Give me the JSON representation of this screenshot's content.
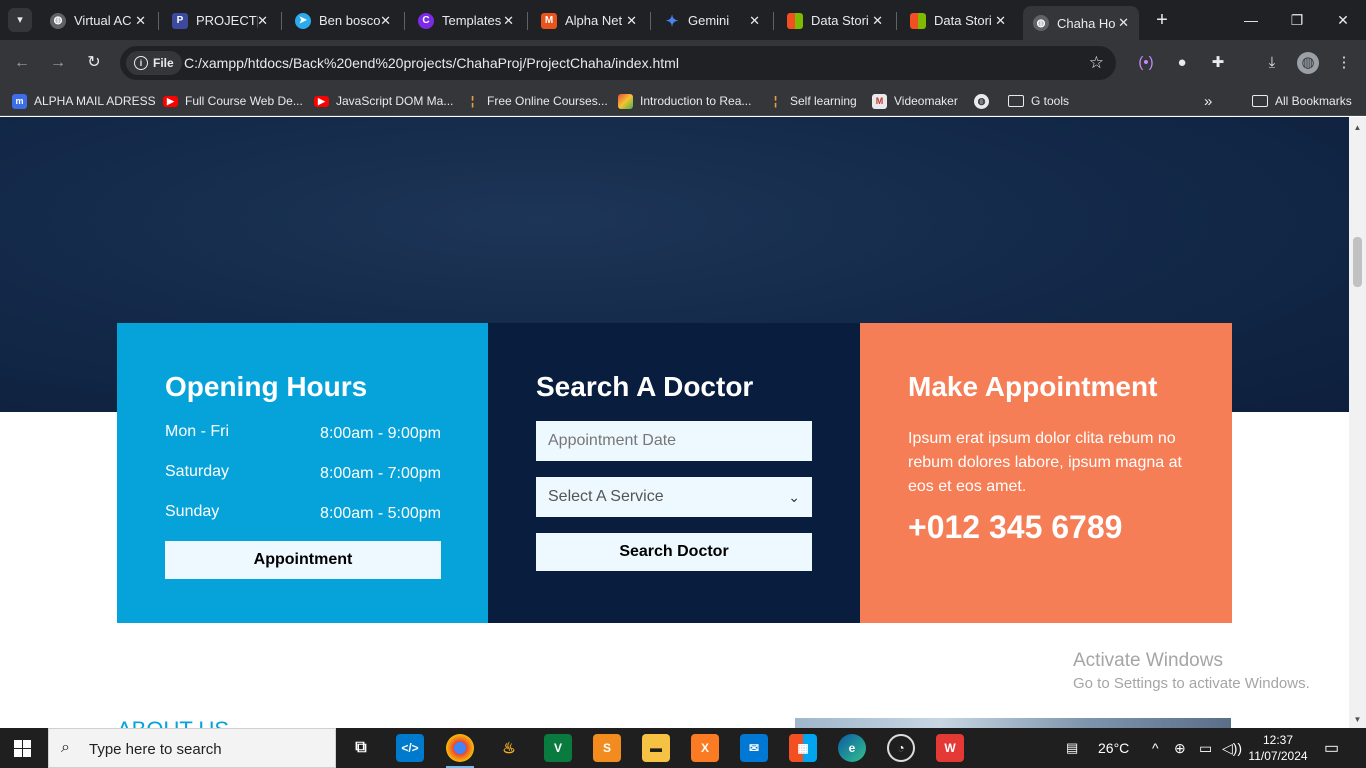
{
  "browser": {
    "tabs": [
      {
        "label": "Virtual AC",
        "icon": "globe-icon",
        "color": "#5f6368"
      },
      {
        "label": "PROJECT|",
        "icon": "project-icon",
        "color": "#3c4a9e"
      },
      {
        "label": "Ben bosco",
        "icon": "telegram-icon",
        "color": "#2aabee"
      },
      {
        "label": "Templates",
        "icon": "canva-icon",
        "color": "#7d2ae8"
      },
      {
        "label": "Alpha Net",
        "icon": "m-icon",
        "color": "#e8541d"
      },
      {
        "label": "Gemini",
        "icon": "gemini-icon",
        "color": "#4b82f1"
      },
      {
        "label": "Data Stori",
        "icon": "windows-icon",
        "color": "#f25022"
      },
      {
        "label": "Data Stori",
        "icon": "windows-icon",
        "color": "#f25022"
      },
      {
        "label": "Chaha Ho",
        "icon": "globe-icon",
        "color": "#5f6368"
      }
    ],
    "url_chip": "File",
    "url": "C:/xampp/htdocs/Back%20end%20projects/ChahaProj/ProjectChaha/index.html",
    "bookmarks": [
      {
        "label": "ALPHA MAIL ADRESS",
        "icon": "m-icon",
        "color": "#3c6ee8"
      },
      {
        "label": "Full Course Web De...",
        "icon": "youtube-icon",
        "color": "#ff0000"
      },
      {
        "label": "JavaScript DOM Ma...",
        "icon": "youtube-icon",
        "color": "#ff0000"
      },
      {
        "label": "Free Online Courses...",
        "icon": "chart-icon",
        "color": "#e8a33c"
      },
      {
        "label": "Introduction to Rea...",
        "icon": "coursera-icon",
        "color": "#e84c3c"
      },
      {
        "label": "Self learning",
        "icon": "chart-icon",
        "color": "#e8a33c"
      },
      {
        "label": "Videomaker",
        "icon": "video-icon",
        "color": "#e8eaed"
      },
      {
        "label": "G tools",
        "icon": "folder-icon",
        "color": "#e8eaed"
      }
    ],
    "all_bookmarks": "All Bookmarks"
  },
  "page": {
    "opening_hours": {
      "title": "Opening Hours",
      "rows": [
        {
          "day": "Mon - Fri",
          "time": "8:00am - 9:00pm"
        },
        {
          "day": "Saturday",
          "time": "8:00am - 7:00pm"
        },
        {
          "day": "Sunday",
          "time": "8:00am - 5:00pm"
        }
      ],
      "button": "Appointment"
    },
    "search_doctor": {
      "title": "Search A Doctor",
      "date_placeholder": "Appointment Date",
      "service_selected": "Select A Service",
      "button": "Search Doctor"
    },
    "make_appointment": {
      "title": "Make Appointment",
      "text": "Ipsum erat ipsum dolor clita rebum no rebum dolores labore, ipsum magna at eos et eos amet.",
      "phone": "+012 345 6789"
    },
    "about_heading": "ABOUT US",
    "colors": {
      "blue": "#06a3da",
      "navy": "#091e3e",
      "orange": "#f57e57"
    }
  },
  "windows": {
    "activate_title": "Activate Windows",
    "activate_sub": "Go to Settings to activate Windows.",
    "search_placeholder": "Type here to search",
    "weather": "26°C",
    "time": "12:37",
    "date": "11/07/2024"
  }
}
